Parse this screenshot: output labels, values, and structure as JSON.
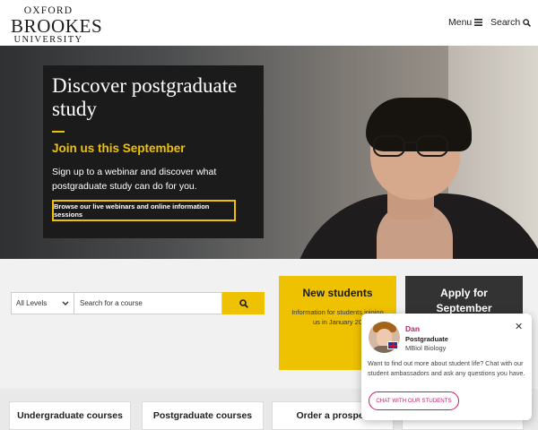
{
  "header": {
    "logo": {
      "line1": "OXFORD",
      "line2": "BROOKES",
      "line3": "UNIVERSITY"
    },
    "menu_label": "Menu",
    "menu_icon": "hamburger-icon",
    "search_label": "Search",
    "search_icon": "search-icon"
  },
  "hero": {
    "title": "Discover postgraduate study",
    "subtitle": "Join us this September",
    "text": "Sign up to a webinar and discover what postgraduate study can do for you.",
    "button_label": "Browse our live webinars and online information sessions",
    "accent_color": "#eec200"
  },
  "search": {
    "level_selected": "All Levels",
    "placeholder": "Search for a course",
    "button_icon": "search-icon"
  },
  "cards": {
    "new_students": {
      "title": "New students",
      "description": "Information for students joining us in January 20"
    },
    "apply": {
      "title": "Apply for September"
    }
  },
  "quick_links": [
    {
      "label": "Undergraduate courses"
    },
    {
      "label": "Postgraduate courses"
    },
    {
      "label": "Order a prospec"
    },
    {
      "label": ""
    }
  ],
  "chat": {
    "name": "Dan",
    "role": "Postgraduate",
    "course": "MBiol Biology",
    "flag_icon": "uk-flag-icon",
    "message": "Want to find out more about student life? Chat with our student ambassadors and ask any questions you have.",
    "button_label": "CHAT WITH OUR STUDENTS",
    "accent_color": "#c21e6b"
  }
}
